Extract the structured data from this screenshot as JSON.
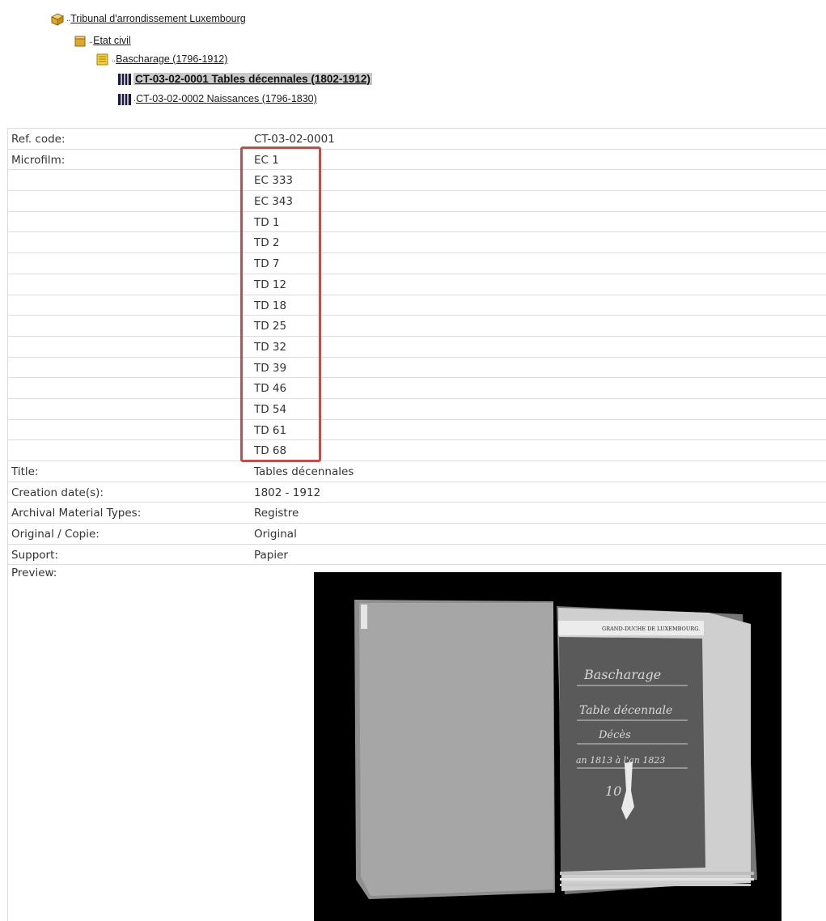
{
  "tree": {
    "items": [
      {
        "label": "Tribunal d'arrondissement Luxembourg",
        "icon": "archive-box-icon"
      },
      {
        "label": "Etat civil",
        "icon": "archive-box-icon"
      },
      {
        "label": "Bascharage (1796-1912)",
        "icon": "folder-stack-icon"
      },
      {
        "label": "CT-03-02-0001 Tables décennales (1802-1912)",
        "icon": "film-reel-icon"
      },
      {
        "label": "CT-03-02-0002 Naissances (1796-1830)",
        "icon": "film-reel-icon"
      }
    ]
  },
  "details": {
    "ref_code": {
      "label": "Ref. code:",
      "value": "CT-03-02-0001"
    },
    "microfilm": {
      "label": "Microfilm:",
      "values": [
        "EC 1",
        "EC 333",
        "EC 343",
        "TD 1",
        "TD 2",
        "TD 7",
        "TD 12",
        "TD 18",
        "TD 25",
        "TD 32",
        "TD 39",
        "TD 46",
        "TD 54",
        "TD 61",
        "TD 68"
      ]
    },
    "title": {
      "label": "Title:",
      "value": "Tables décennales"
    },
    "creation": {
      "label": "Creation date(s):",
      "value": "1802 - 1912"
    },
    "types": {
      "label": "Archival Material Types:",
      "value": "Registre"
    },
    "original": {
      "label": "Original / Copie:",
      "value": "Original"
    },
    "support": {
      "label": "Support:",
      "value": "Papier"
    },
    "preview": {
      "label": "Preview:"
    }
  },
  "preview_image": {
    "header": "GRAND-DUCHE DE LUXEMBOURG.",
    "lines": [
      "Bascharage",
      "Table décennale",
      "Décès",
      "an 1813 à l'an 1823",
      "10"
    ]
  },
  "colors": {
    "highlight": "#c0504d",
    "selected_bg": "#c9c9c9",
    "grid": "#dcdcdc"
  }
}
